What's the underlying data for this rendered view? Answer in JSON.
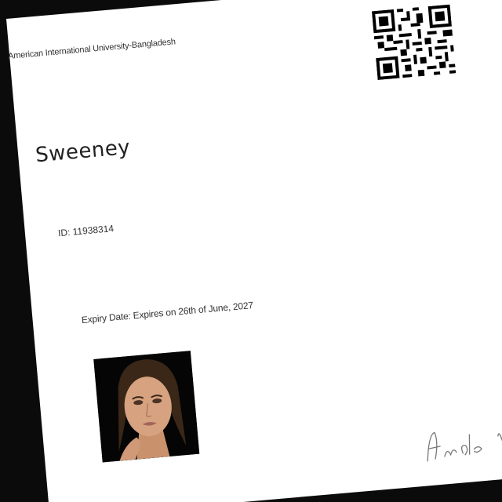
{
  "card": {
    "university": "American International University-Bangladesh",
    "name": "Sweeney",
    "id_label": "ID:",
    "id_value": "11938314",
    "expiry_label": "Expiry Date:",
    "expiry_value": "Expires on 26th of June, 2027"
  },
  "colors": {
    "background": "#0b0b0b",
    "card": "#ffffff",
    "text": "#2a2a2a",
    "photo_background": "#050505"
  },
  "icons": {
    "qr": "qr-code-icon"
  }
}
